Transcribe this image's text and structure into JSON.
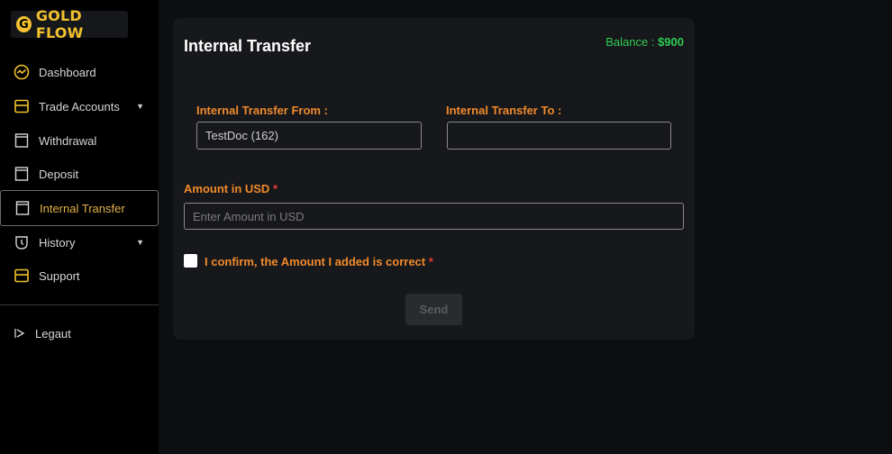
{
  "brand": {
    "logo_letter": "G",
    "name": "GOLD FLOW",
    "color": "#f2c12e"
  },
  "sidebar": {
    "items": [
      {
        "label": "Dashboard",
        "icon": "dashboard-icon"
      },
      {
        "label": "Trade Accounts",
        "icon": "wallet-icon",
        "has_dropdown": true
      },
      {
        "label": "Withdrawal",
        "icon": "document-icon"
      },
      {
        "label": "Deposit",
        "icon": "document-icon"
      },
      {
        "label": "Internal Transfer",
        "icon": "document-icon",
        "active": true
      },
      {
        "label": "History",
        "icon": "history-icon",
        "has_dropdown": true
      },
      {
        "label": "Support",
        "icon": "support-icon"
      }
    ],
    "logout_label": "Legaut",
    "caret": "▼"
  },
  "transfer": {
    "title": "Internal Transfer",
    "balance_label": "Balance :",
    "balance_value": "$900",
    "from_label": "Internal Transfer From :",
    "from_value": "TestDoc (162)",
    "to_label": "Internal Transfer To :",
    "to_value": "",
    "amount_label": "Amount in USD",
    "amount_placeholder": "Enter Amount in USD",
    "required_mark": "*",
    "confirm_label": "I confirm, the Amount I added is correct",
    "confirm_checked": false,
    "send_label": "Send"
  },
  "colors": {
    "accent_orange": "#f08a2c",
    "balance_green": "#2ecc52",
    "active_gold": "#e2b24a",
    "required_red": "#e53935"
  }
}
